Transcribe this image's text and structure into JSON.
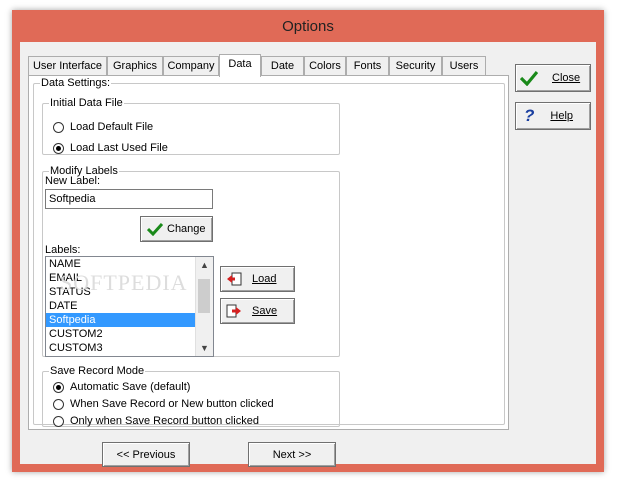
{
  "window": {
    "title": "Options"
  },
  "tabs": [
    {
      "label": "User Interface"
    },
    {
      "label": "Graphics"
    },
    {
      "label": "Company"
    },
    {
      "label": "Data"
    },
    {
      "label": "Date"
    },
    {
      "label": "Colors"
    },
    {
      "label": "Fonts"
    },
    {
      "label": "Security"
    },
    {
      "label": "Users"
    }
  ],
  "active_tab": "Data",
  "data_settings": {
    "legend": "Data Settings:"
  },
  "initial_file": {
    "legend": "Initial Data File",
    "options": [
      {
        "label": "Load Default File",
        "selected": false
      },
      {
        "label": "Load Last Used File",
        "selected": true
      }
    ]
  },
  "modify_labels": {
    "legend": "Modify Labels",
    "new_label_caption": "New Label:",
    "new_label_value": "Softpedia",
    "change_label": "Change",
    "labels_caption": "Labels:",
    "labels": [
      "NAME",
      "EMAIL",
      "STATUS",
      "DATE",
      "Softpedia",
      "CUSTOM2",
      "CUSTOM3"
    ],
    "selected_label": "Softpedia",
    "load_label": "Load",
    "save_label": "Save"
  },
  "save_mode": {
    "legend": "Save Record Mode",
    "options": [
      {
        "label": "Automatic Save (default)",
        "selected": true
      },
      {
        "label": "When Save Record or New button clicked",
        "selected": false
      },
      {
        "label": "Only when Save Record button clicked",
        "selected": false
      }
    ]
  },
  "side_buttons": {
    "close_label": "Close",
    "help_label": "Help"
  },
  "nav": {
    "previous_label": "<< Previous",
    "next_label": "Next >>"
  },
  "watermark": "SOFTPEDIA",
  "colors": {
    "title_bar": "#e06a57",
    "selection": "#3399ff",
    "check_green": "#1a8a1a",
    "help_blue": "#1a3fa0",
    "arrow_red": "#d42020"
  }
}
